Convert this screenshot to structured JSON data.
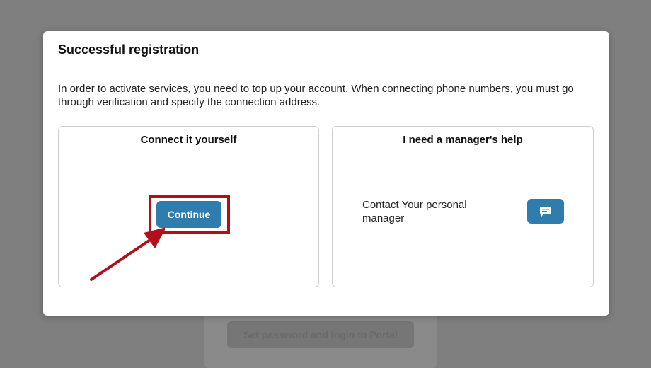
{
  "background": {
    "login_button_label": "Set password and login to Portal"
  },
  "modal": {
    "title": "Successful registration",
    "message": "In order to activate services, you need to top up your account. When connecting phone numbers, you must go through verification and specify the connection address.",
    "self_panel": {
      "title": "Connect it yourself",
      "continue_label": "Continue"
    },
    "manager_panel": {
      "title": "I need a manager's help",
      "contact_text": "Contact Your personal manager",
      "chat_icon": "chat-bubble-icon"
    }
  },
  "colors": {
    "accent": "#2f7dad",
    "highlight": "#b0101c",
    "overlay": "#7f7f7f"
  }
}
